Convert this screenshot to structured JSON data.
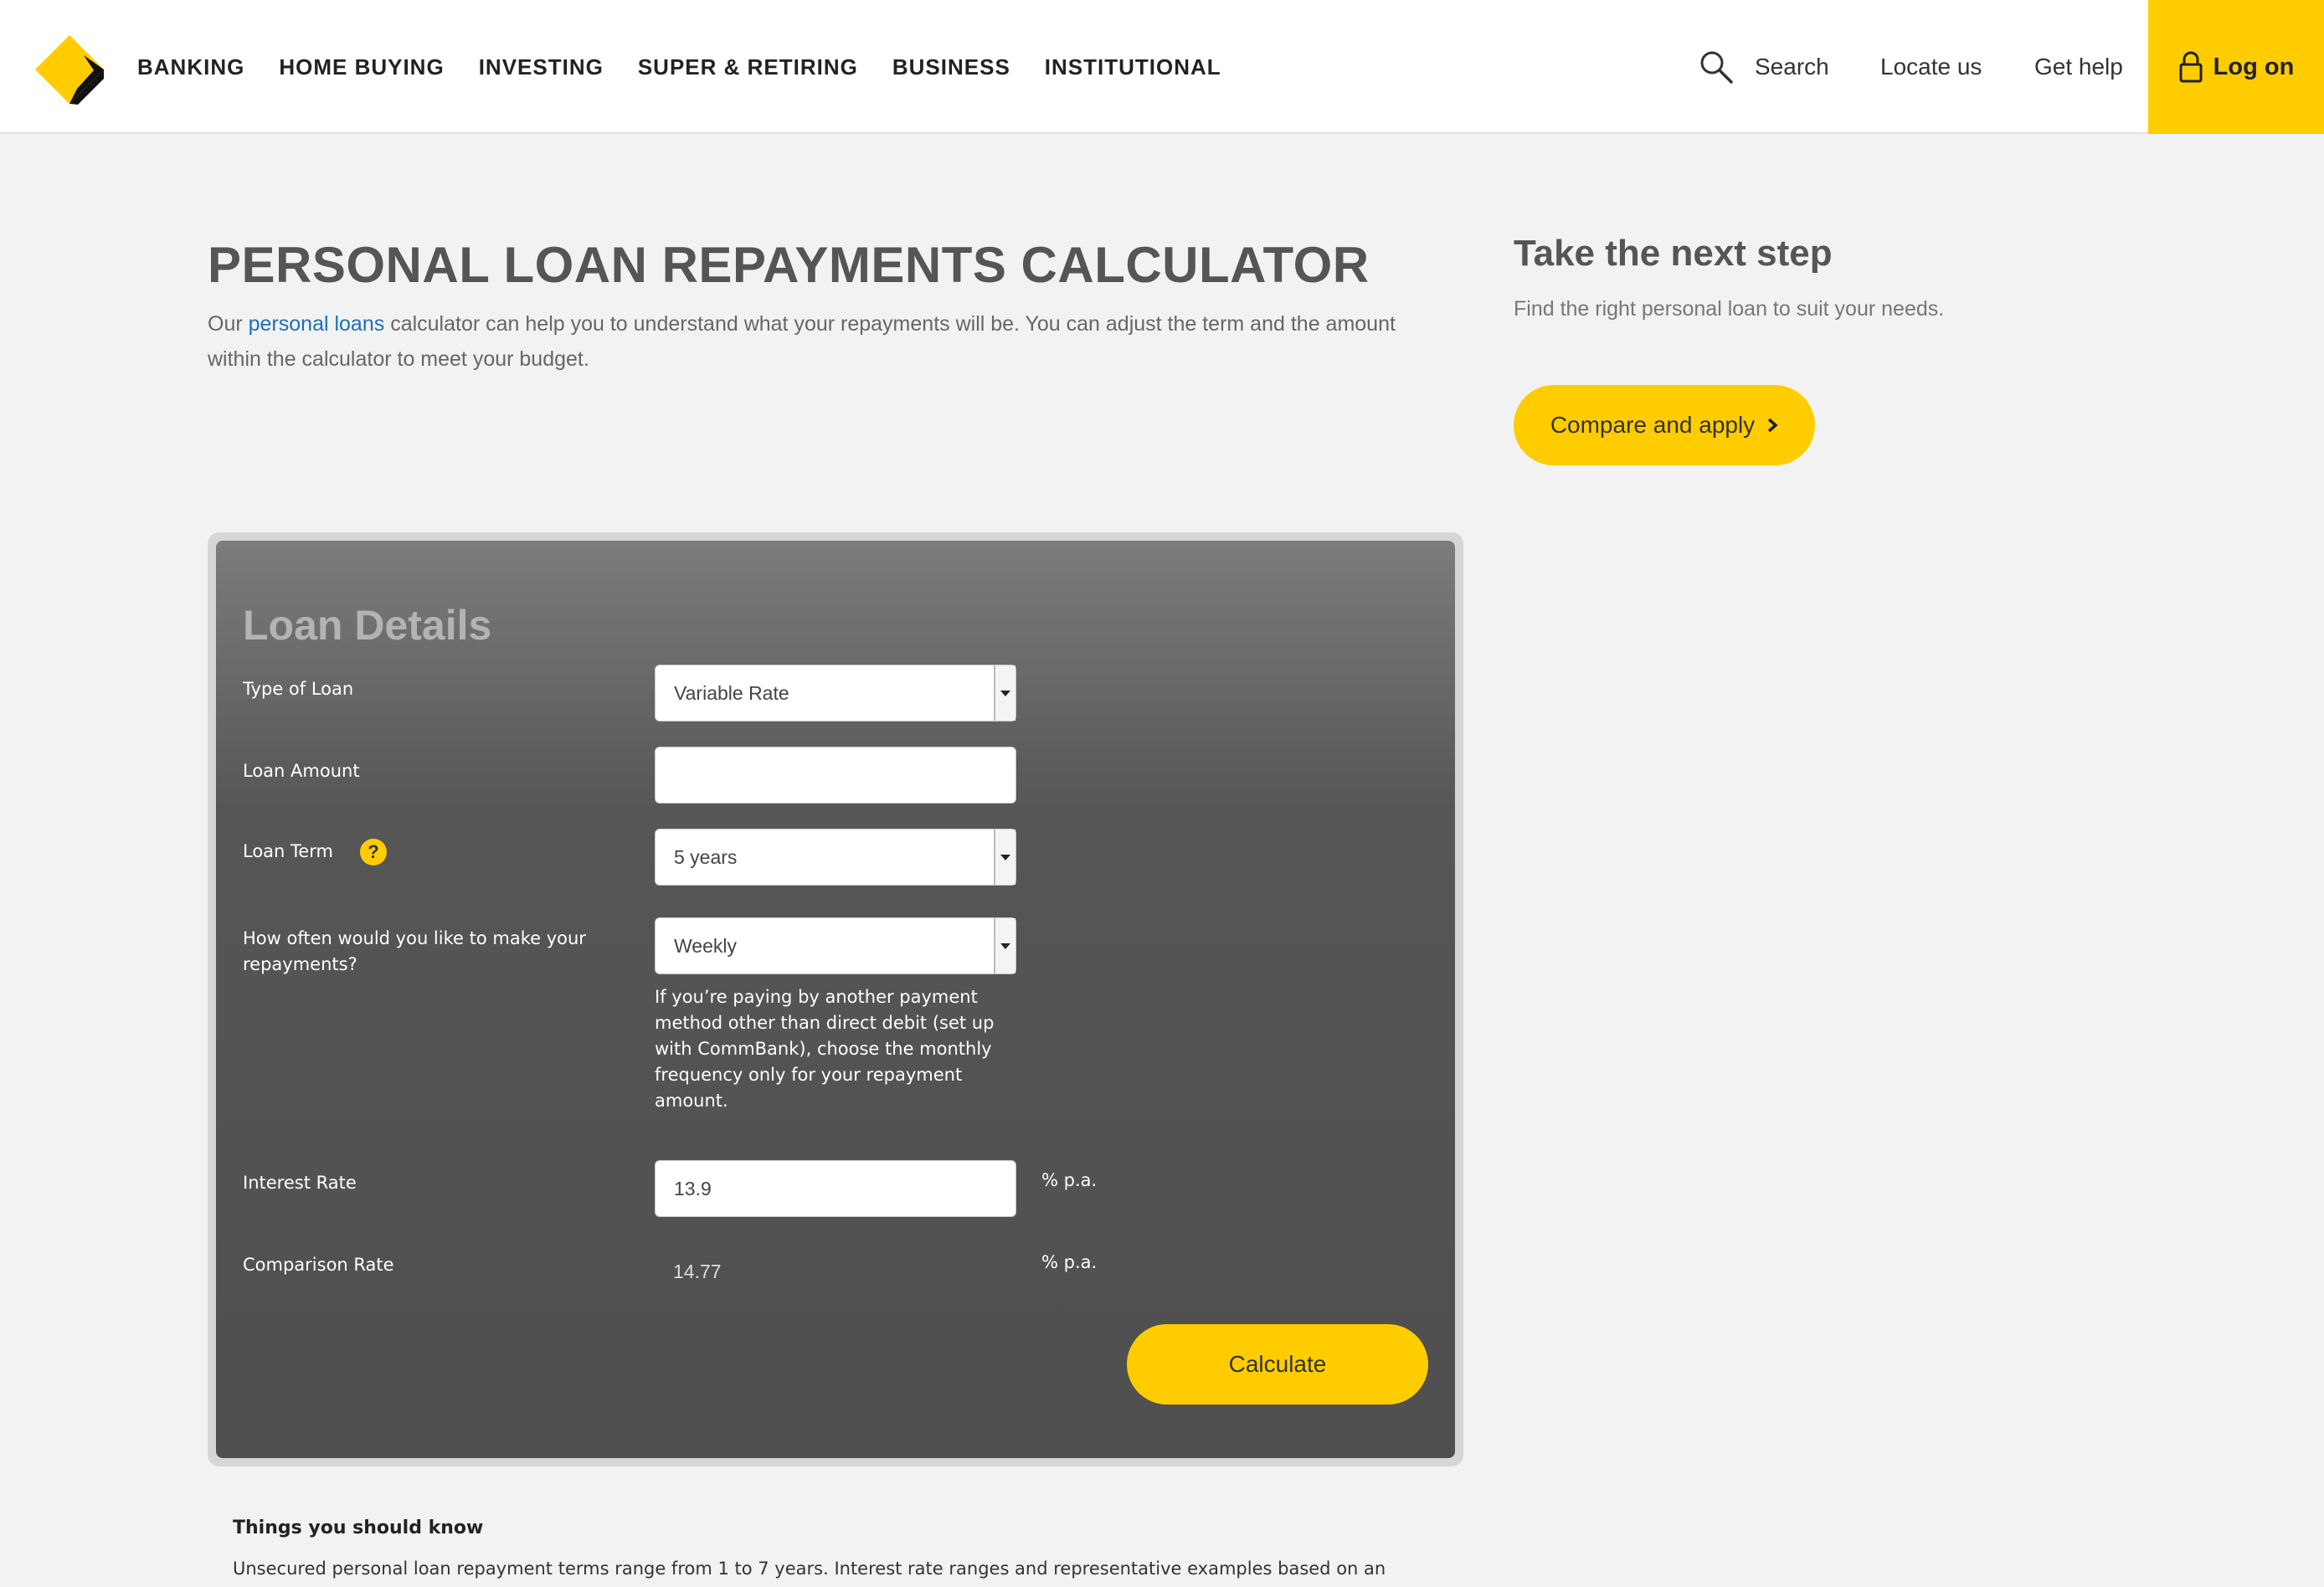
{
  "header": {
    "nav": [
      "BANKING",
      "HOME BUYING",
      "INVESTING",
      "SUPER & RETIRING",
      "BUSINESS",
      "INSTITUTIONAL"
    ],
    "search_label": "Search",
    "locate_label": "Locate us",
    "help_label": "Get help",
    "logon_label": "Log on",
    "brand_color": "#ffcc00"
  },
  "intro": {
    "title": "PERSONAL LOAN REPAYMENTS CALCULATOR",
    "text_before_link": "Our ",
    "link_text": "personal loans",
    "text_after_link": " calculator can help you to understand what your repayments will be. You can adjust the term and the amount within the calculator to meet your budget."
  },
  "side": {
    "title": "Take the next step",
    "text": "Find the right personal loan to suit your needs.",
    "button_label": "Compare and apply"
  },
  "calculator": {
    "title": "Loan Details",
    "type_label": "Type of Loan",
    "type_value": "Variable Rate",
    "amount_label": "Loan Amount",
    "amount_value": "",
    "term_label": "Loan Term",
    "term_value": "5 years",
    "frequency_label": "How often would you like to make your repayments?",
    "frequency_value": "Weekly",
    "frequency_note": "If you’re paying by another payment method other than direct debit (set up with CommBank), choose the monthly frequency only for your repayment amount.",
    "interest_label": "Interest Rate",
    "interest_value": "13.9",
    "interest_unit": "% p.a.",
    "comparison_label": "Comparison Rate",
    "comparison_value": "14.77",
    "comparison_unit": "% p.a.",
    "calculate_label": "Calculate",
    "help_glyph": "?"
  },
  "info": {
    "title": "Things you should know",
    "text": "Unsecured personal loan repayment terms range from 1 to 7 years. Interest rate ranges and representative examples based on an"
  }
}
